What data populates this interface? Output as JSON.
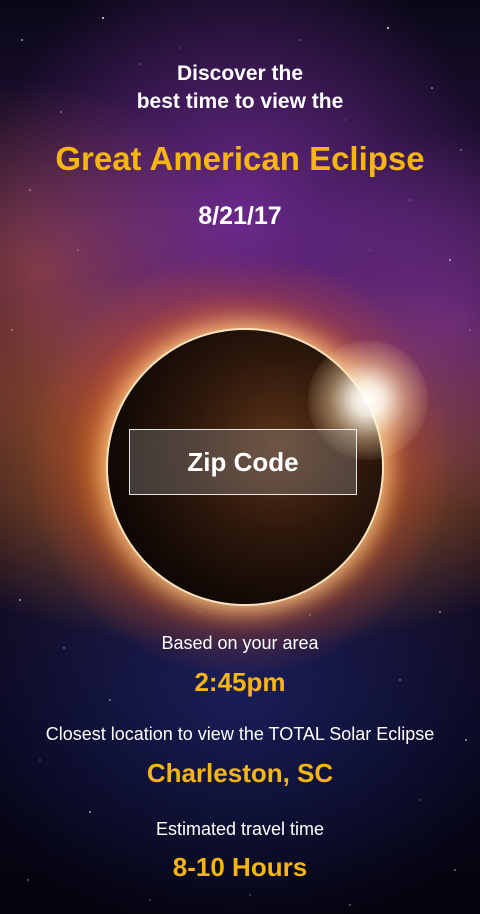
{
  "header": {
    "line1": "Discover the",
    "line2": "best time to view the",
    "title": "Great American Eclipse",
    "date": "8/21/17"
  },
  "zip": {
    "placeholder": "Zip Code"
  },
  "results": {
    "time_label": "Based on your area",
    "time_value": "2:45pm",
    "location_label": "Closest location to view the TOTAL Solar Eclipse",
    "location_value": "Charleston, SC",
    "travel_label": "Estimated travel time",
    "travel_value": "8-10 Hours"
  },
  "colors": {
    "accent": "#f7b512",
    "text": "#ffffff",
    "background": "#05040f"
  }
}
